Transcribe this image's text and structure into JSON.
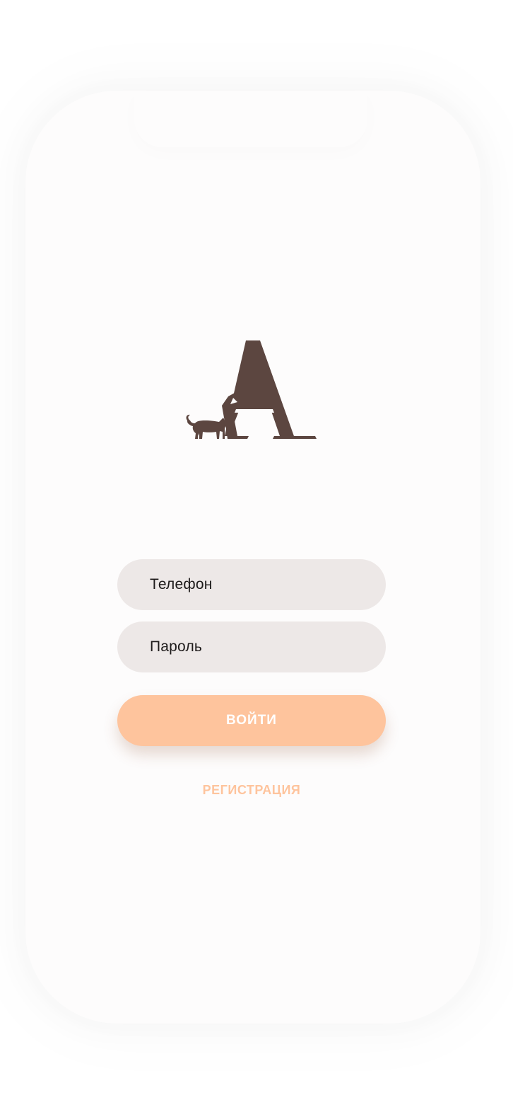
{
  "login": {
    "phone_placeholder": "Телефон",
    "password_placeholder": "Пароль",
    "login_button": "ВОЙТИ",
    "register_link": "РЕГИСТРАЦИЯ"
  },
  "logo": {
    "letter": "A",
    "icon": "cat-and-dog-silhouette-logo"
  },
  "colors": {
    "brand_brown": "#5c4640",
    "accent_peach": "#fec49d",
    "field_bg": "#ede8e7",
    "screen_bg": "#fdfcfc"
  }
}
